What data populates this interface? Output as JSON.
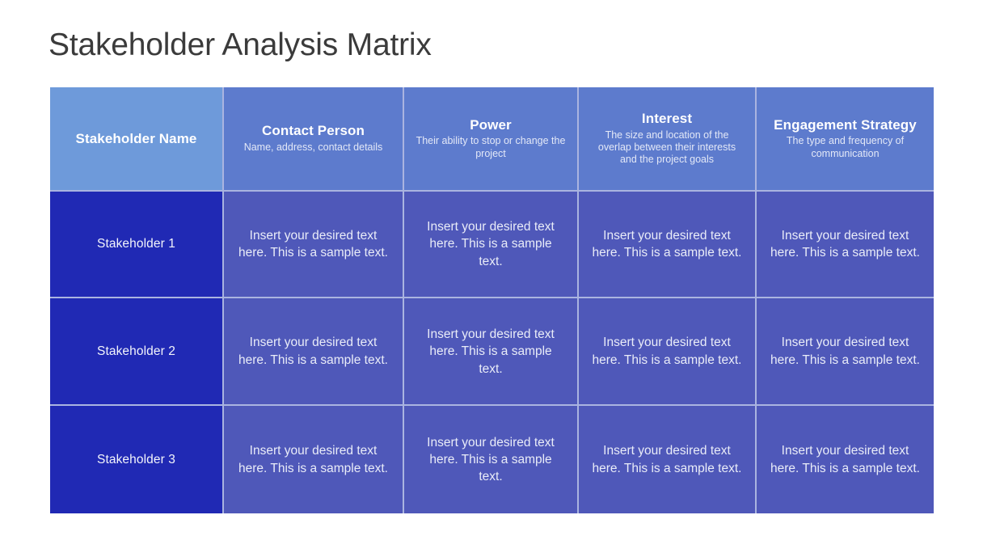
{
  "slide": {
    "title": "Stakeholder Analysis Matrix",
    "background_color": "#ffffff",
    "title_color": "#3b3b3b"
  },
  "colors": {
    "header_first": "#6e9ada",
    "header_rest": "#5d7bcd",
    "name_cell": "#2029b4",
    "text_cell": "#4f58b9",
    "grid_line": "#aab4e0",
    "header_text": "#ffffff",
    "header_subtext": "#e3e8f7",
    "body_text": "#e9ecf8"
  },
  "table": {
    "headers": [
      {
        "title": "Stakeholder Name",
        "subtitle": ""
      },
      {
        "title": "Contact Person",
        "subtitle": "Name, address, contact details"
      },
      {
        "title": "Power",
        "subtitle": "Their ability to stop or change the project"
      },
      {
        "title": "Interest",
        "subtitle": "The size and location of the overlap between their interests and the project goals"
      },
      {
        "title": "Engagement Strategy",
        "subtitle": "The type and frequency of communication"
      }
    ],
    "rows": [
      {
        "name": "Stakeholder 1",
        "cells": [
          "Insert your desired text here. This is a sample text.",
          "Insert your desired text here. This is a sample text.",
          "Insert your desired text here. This is a sample text.",
          "Insert your desired text here. This is a sample text."
        ]
      },
      {
        "name": "Stakeholder 2",
        "cells": [
          "Insert your desired text here. This is a sample text.",
          "Insert your desired text here. This is a sample text.",
          "Insert your desired text here. This is a sample text.",
          "Insert your desired text here. This is a sample text."
        ]
      },
      {
        "name": "Stakeholder 3",
        "cells": [
          "Insert your desired text here. This is a sample text.",
          "Insert your desired text here. This is a sample text.",
          "Insert your desired text here. This is a sample text.",
          "Insert your desired text here. This is a sample text."
        ]
      }
    ]
  }
}
